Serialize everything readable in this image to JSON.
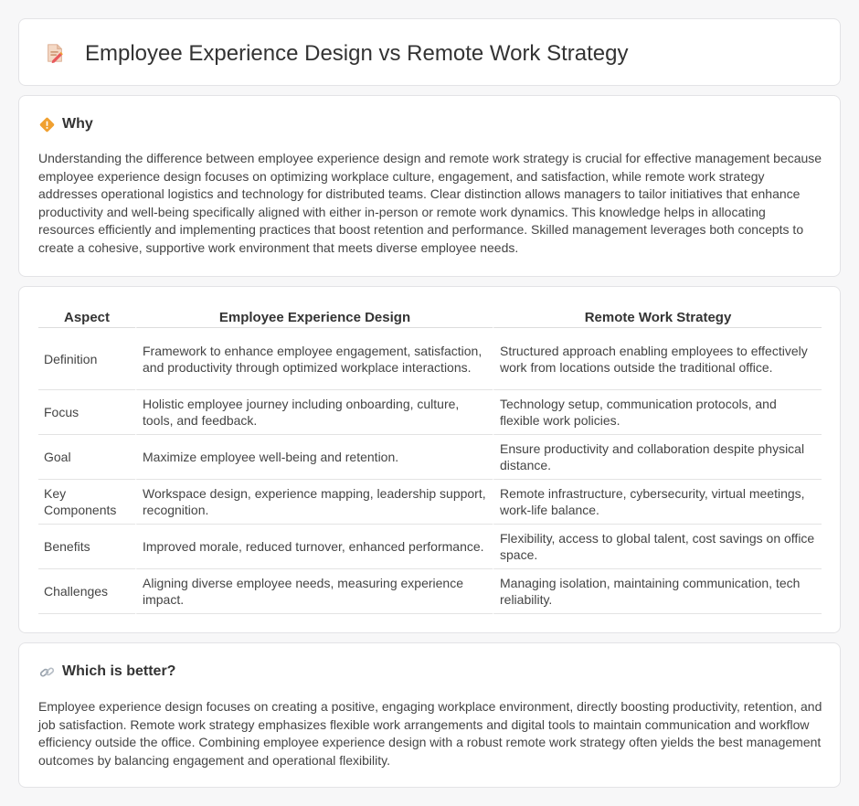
{
  "page": {
    "title": "Employee Experience Design vs Remote Work Strategy",
    "title_icon": "document-pencil-icon"
  },
  "why": {
    "icon": "diamond-warning-icon",
    "heading": "Why",
    "body": "Understanding the difference between employee experience design and remote work strategy is crucial for effective management because employee experience design focuses on optimizing workplace culture, engagement, and satisfaction, while remote work strategy addresses operational logistics and technology for distributed teams. Clear distinction allows managers to tailor initiatives that enhance productivity and well-being specifically aligned with either in-person or remote work dynamics. This knowledge helps in allocating resources efficiently and implementing practices that boost retention and performance. Skilled management leverages both concepts to create a cohesive, supportive work environment that meets diverse employee needs."
  },
  "table": {
    "headers": [
      "Aspect",
      "Employee Experience Design",
      "Remote Work Strategy"
    ],
    "rows": [
      {
        "aspect": "Definition",
        "eed": "Framework to enhance employee engagement, satisfaction, and productivity through optimized workplace interactions.",
        "rws": "Structured approach enabling employees to effectively work from locations outside the traditional office."
      },
      {
        "aspect": "Focus",
        "eed": "Holistic employee journey including onboarding, culture, tools, and feedback.",
        "rws": "Technology setup, communication protocols, and flexible work policies."
      },
      {
        "aspect": "Goal",
        "eed": "Maximize employee well-being and retention.",
        "rws": "Ensure productivity and collaboration despite physical distance."
      },
      {
        "aspect": "Key Components",
        "eed": "Workspace design, experience mapping, leadership support, recognition.",
        "rws": "Remote infrastructure, cybersecurity, virtual meetings, work-life balance."
      },
      {
        "aspect": "Benefits",
        "eed": "Improved morale, reduced turnover, enhanced performance.",
        "rws": "Flexibility, access to global talent, cost savings on office space."
      },
      {
        "aspect": "Challenges",
        "eed": "Aligning diverse employee needs, measuring experience impact.",
        "rws": "Managing isolation, maintaining communication, tech reliability."
      }
    ]
  },
  "better": {
    "icon": "link-icon",
    "heading": "Which is better?",
    "body": "Employee experience design focuses on creating a positive, engaging workplace environment, directly boosting productivity, retention, and job satisfaction. Remote work strategy emphasizes flexible work arrangements and digital tools to maintain communication and workflow efficiency outside the office. Combining employee experience design with a robust remote work strategy often yields the best management outcomes by balancing engagement and operational flexibility."
  },
  "colors": {
    "background": "#f7f7f8",
    "card": "#ffffff",
    "border": "#e3e3e6",
    "icon_orange": "#f0a030",
    "icon_pink": "#e86a8a"
  }
}
